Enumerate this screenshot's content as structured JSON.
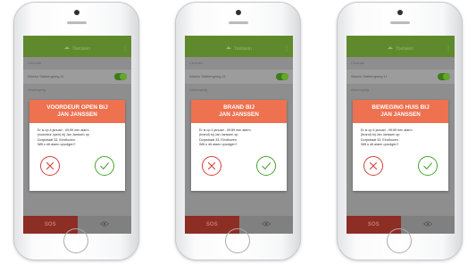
{
  "colors": {
    "status_bar": "#5f8a2c",
    "app_bar": "#5e8a2d",
    "dialog_header": "#ee7150",
    "sos_tab": "#8d2e25",
    "toggle_on": "#62a82a",
    "cancel": "#d43f3a",
    "confirm": "#47a331"
  },
  "phones": [
    {
      "status": {
        "carrier": "",
        "time": "",
        "battery": ""
      },
      "app_bar": {
        "title": "Toetsiein",
        "home_icon": "home-icon",
        "menu_icon": "more-vertical-icon"
      },
      "section_control": "Centrale",
      "device_name": "Wacko Stalbergweg 11",
      "device_toggle_on": true,
      "section_alarm": "Alarmopsig",
      "dialog": {
        "title_line1": "VOORDEUR OPEN BIJ",
        "title_line2": "JAN JANSSEN",
        "body_line1": "Er is op 4 januari - 09:59 een alarm",
        "body_line2": "(voordeur open) bij Jan Janssen op",
        "body_line3": "Dorpstraat 33, Eindhoven.",
        "body_line4": "Wilt u dit alarm opvolgen?",
        "cancel_icon": "close-icon",
        "confirm_icon": "checkmark-icon"
      },
      "nav": {
        "sos_label": "SOS",
        "eye_icon": "eye-icon"
      }
    },
    {
      "status": {
        "carrier": "",
        "time": "",
        "battery": ""
      },
      "app_bar": {
        "title": "Toetsiein",
        "home_icon": "home-icon",
        "menu_icon": "more-vertical-icon"
      },
      "section_control": "Centrale",
      "device_name": "Wacko Stalbergweg 11",
      "device_toggle_on": true,
      "section_alarm": "Alarmopsig",
      "dialog": {
        "title_line1": "BRAND BIJ",
        "title_line2": "JAN JANSSEN",
        "body_line1": "Er is op 4 januari - 09:59 een alarm",
        "body_line2": "(brand) bij Jan Janssen op",
        "body_line3": "Dorpstraat 33, Eindhoven.",
        "body_line4": "Wilt u dit alarm opvolgen?",
        "cancel_icon": "close-icon",
        "confirm_icon": "checkmark-icon"
      },
      "nav": {
        "sos_label": "SOS",
        "eye_icon": "eye-icon"
      }
    },
    {
      "status": {
        "carrier": "",
        "time": "",
        "battery": ""
      },
      "app_bar": {
        "title": "Toetsiein",
        "home_icon": "home-icon",
        "menu_icon": "more-vertical-icon"
      },
      "section_control": "Centrale",
      "device_name": "Wacko Stalbergweg 11",
      "device_toggle_on": true,
      "section_alarm": "Alarmopsig",
      "dialog": {
        "title_line1": "BEWEGING HUIS BIJ",
        "title_line2": "JAN JANSSEN",
        "body_line1": "Er is op 4 januari - 09:59 een alarm",
        "body_line2": "(brand) bij Jan Janssen op",
        "body_line3": "Dorpstraat 33, Eindhoven.",
        "body_line4": "Wilt u dit alarm opvolgen?",
        "cancel_icon": "close-icon",
        "confirm_icon": "checkmark-icon"
      },
      "nav": {
        "sos_label": "SOS",
        "eye_icon": "eye-icon"
      }
    }
  ]
}
